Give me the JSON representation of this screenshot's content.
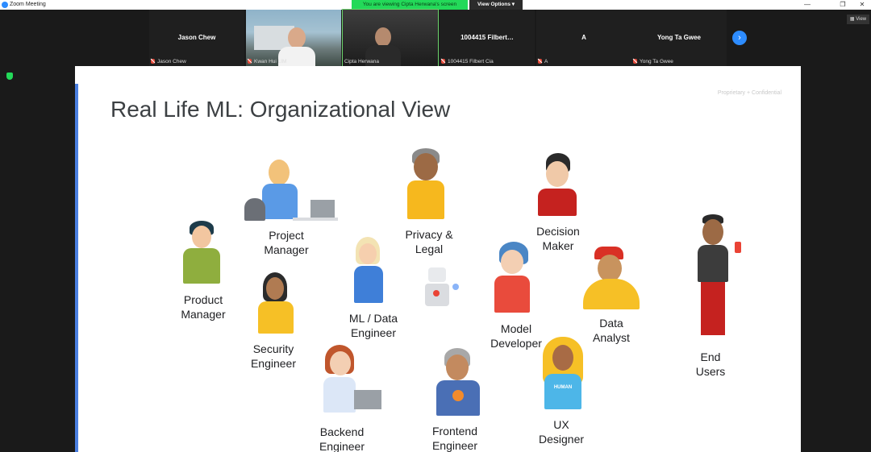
{
  "window": {
    "title": "Zoom Meeting",
    "minimize": "—",
    "maximize": "❐",
    "close": "✕"
  },
  "share": {
    "banner": "You are viewing Cipta Herwana's screen",
    "view_options": "View Options ▾",
    "view_label": "View"
  },
  "gallery": {
    "tiles": [
      {
        "name": "Jason Chew",
        "label": "Jason Chew",
        "video": false
      },
      {
        "name": "",
        "label": "Kwan Hui LIM",
        "video": true
      },
      {
        "name": "",
        "label": "Cipta Herwana",
        "video": true
      },
      {
        "name": "1004415 Filbert…",
        "label": "1004415 Filbert Cia",
        "video": false
      },
      {
        "name": "A",
        "label": "A",
        "video": false
      },
      {
        "name": "Yong Ta Gwee",
        "label": "Yong Ta Gwee",
        "video": false
      }
    ],
    "next_arrow": "›"
  },
  "slide": {
    "title": "Real Life ML: Organizational View",
    "confidential": "Proprietary + Confidential",
    "roles": [
      {
        "id": "product-manager",
        "line1": "Product",
        "line2": "Manager"
      },
      {
        "id": "project-manager",
        "line1": "Project",
        "line2": "Manager"
      },
      {
        "id": "security-engineer",
        "line1": "Security",
        "line2": "Engineer"
      },
      {
        "id": "ml-data-engineer",
        "line1": "ML / Data",
        "line2": "Engineer"
      },
      {
        "id": "privacy-legal",
        "line1": "Privacy &",
        "line2": "Legal"
      },
      {
        "id": "decision-maker",
        "line1": "Decision",
        "line2": "Maker"
      },
      {
        "id": "model-developer",
        "line1": "Model",
        "line2": "Developer"
      },
      {
        "id": "data-analyst",
        "line1": "Data",
        "line2": "Analyst"
      },
      {
        "id": "end-users",
        "line1": "End",
        "line2": "Users"
      },
      {
        "id": "backend-engineer",
        "line1": "Backend",
        "line2": "Engineer"
      },
      {
        "id": "frontend-engineer",
        "line1": "Frontend",
        "line2": "Engineer"
      },
      {
        "id": "ux-designer",
        "line1": "UX",
        "line2": "Designer"
      }
    ],
    "human_shirt": "HUMAN",
    "accent_color": "#4a7fe0"
  },
  "colors": {
    "banner_green": "#23d959",
    "zoom_blue": "#2d8cff",
    "mic_muted": "#e74c3c"
  }
}
